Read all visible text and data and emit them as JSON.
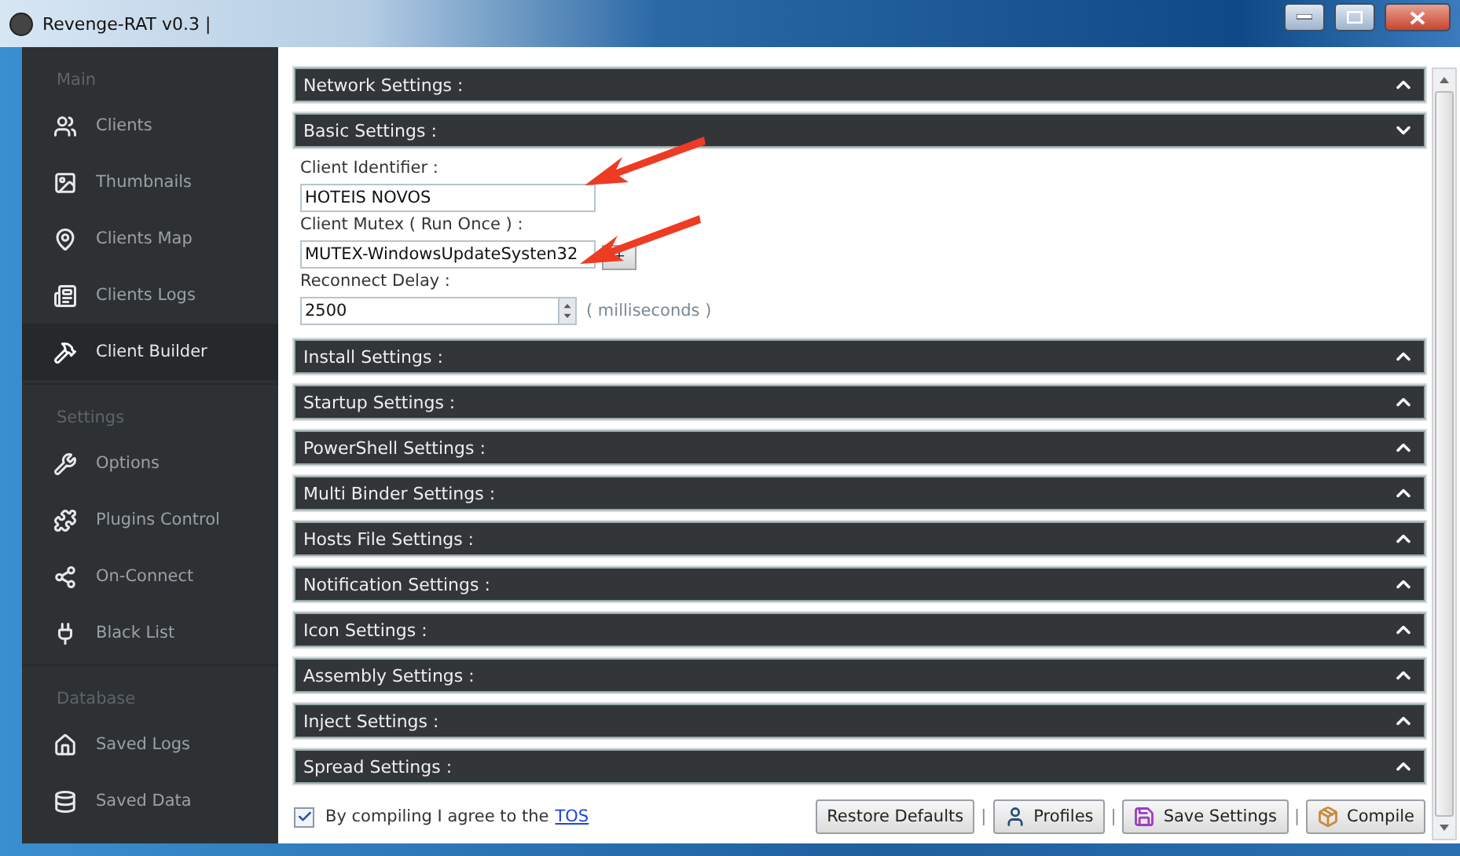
{
  "window": {
    "title": "Revenge-RAT v0.3 |"
  },
  "sidebar": {
    "groups": [
      {
        "label": "Main",
        "items": [
          {
            "label": "Clients",
            "selected": false
          },
          {
            "label": "Thumbnails",
            "selected": false
          },
          {
            "label": "Clients Map",
            "selected": false
          },
          {
            "label": "Clients Logs",
            "selected": false
          },
          {
            "label": "Client Builder",
            "selected": true
          }
        ]
      },
      {
        "label": "Settings",
        "items": [
          {
            "label": "Options",
            "selected": false
          },
          {
            "label": "Plugins Control",
            "selected": false
          },
          {
            "label": "On-Connect",
            "selected": false
          },
          {
            "label": "Black List",
            "selected": false
          }
        ]
      },
      {
        "label": "Database",
        "items": [
          {
            "label": "Saved Logs",
            "selected": false
          },
          {
            "label": "Saved Data",
            "selected": false
          }
        ]
      }
    ]
  },
  "sections": [
    {
      "title": "Network Settings :",
      "expanded": false
    },
    {
      "title": "Basic Settings :",
      "expanded": true,
      "fields": [
        {
          "kind": "text",
          "label": "Client Identifier :",
          "value": "HOTEIS NOVOS"
        },
        {
          "kind": "text_button",
          "label": "Client Mutex ( Run Once ) :",
          "value": "MUTEX-WindowsUpdateSysten32",
          "button": "+"
        },
        {
          "kind": "spinner",
          "label": "Reconnect Delay :",
          "value": "2500",
          "unit": "( milliseconds )"
        }
      ]
    },
    {
      "title": "Install Settings :",
      "expanded": false
    },
    {
      "title": "Startup Settings :",
      "expanded": false
    },
    {
      "title": "PowerShell Settings :",
      "expanded": false
    },
    {
      "title": "Multi Binder Settings :",
      "expanded": false
    },
    {
      "title": "Hosts File Settings :",
      "expanded": false
    },
    {
      "title": "Notification Settings :",
      "expanded": false
    },
    {
      "title": "Icon Settings :",
      "expanded": false
    },
    {
      "title": "Assembly Settings :",
      "expanded": false
    },
    {
      "title": "Inject Settings :",
      "expanded": false
    },
    {
      "title": "Spread Settings :",
      "expanded": false
    }
  ],
  "footer": {
    "agree": {
      "checked": true,
      "text": "By compiling I agree to the",
      "link": "TOS"
    },
    "items": [
      {
        "kind": "button",
        "label": "Restore Defaults"
      },
      {
        "kind": "separator",
        "text": "|"
      },
      {
        "kind": "button",
        "label": "Profiles"
      },
      {
        "kind": "separator",
        "text": "|"
      },
      {
        "kind": "button",
        "label": "Save Settings"
      },
      {
        "kind": "separator",
        "text": "|"
      },
      {
        "kind": "button",
        "label": "Compile"
      }
    ]
  }
}
